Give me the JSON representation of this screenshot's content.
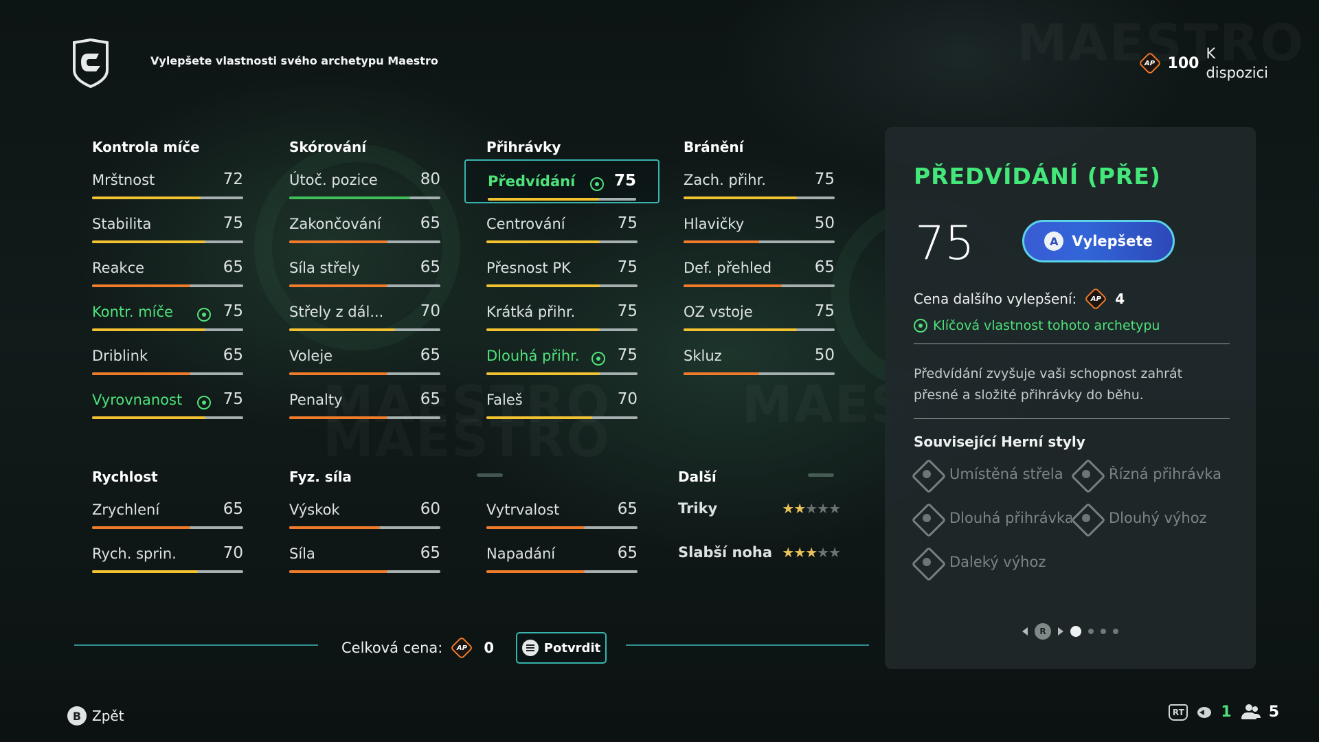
{
  "header": {
    "text": "Vylepšete vlastnosti svého archetypu Maestro",
    "ap_label": "AP",
    "ap_amount": "100",
    "ap_available_line1": "K",
    "ap_available_line2": "dispozici"
  },
  "columns": [
    {
      "title": "Kontrola míče",
      "stats": [
        {
          "name": "Mrštnost",
          "value": "72",
          "key": false,
          "fill": 0.72
        },
        {
          "name": "Stabilita",
          "value": "75",
          "key": false,
          "fill": 0.75
        },
        {
          "name": "Reakce",
          "value": "65",
          "key": false,
          "fill": 0.65
        },
        {
          "name": "Kontr. míče",
          "value": "75",
          "key": true,
          "fill": 0.75
        },
        {
          "name": "Driblink",
          "value": "65",
          "key": false,
          "fill": 0.65
        },
        {
          "name": "Vyrovnanost",
          "value": "75",
          "key": true,
          "fill": 0.75
        }
      ]
    },
    {
      "title": "Skórování",
      "stats": [
        {
          "name": "Útoč. pozice",
          "value": "80",
          "key": false,
          "fill": 0.8
        },
        {
          "name": "Zakončování",
          "value": "65",
          "key": false,
          "fill": 0.65
        },
        {
          "name": "Síla střely",
          "value": "65",
          "key": false,
          "fill": 0.65
        },
        {
          "name": "Střely z dál...",
          "value": "70",
          "key": false,
          "fill": 0.7
        },
        {
          "name": "Voleje",
          "value": "65",
          "key": false,
          "fill": 0.65
        },
        {
          "name": "Penalty",
          "value": "65",
          "key": false,
          "fill": 0.65
        }
      ]
    },
    {
      "title": "Přihrávky",
      "stats": [
        {
          "name": "Předvídání",
          "value": "75",
          "key": true,
          "fill": 0.75,
          "selected": true
        },
        {
          "name": "Centrování",
          "value": "75",
          "key": false,
          "fill": 0.75
        },
        {
          "name": "Přesnost PK",
          "value": "75",
          "key": false,
          "fill": 0.75
        },
        {
          "name": "Krátká přihr.",
          "value": "75",
          "key": false,
          "fill": 0.75
        },
        {
          "name": "Dlouhá přihr.",
          "value": "75",
          "key": true,
          "fill": 0.75
        },
        {
          "name": "Faleš",
          "value": "70",
          "key": false,
          "fill": 0.7
        }
      ]
    },
    {
      "title": "Bránění",
      "stats": [
        {
          "name": "Zach. přihr.",
          "value": "75",
          "key": false,
          "fill": 0.75
        },
        {
          "name": "Hlavičky",
          "value": "50",
          "key": false,
          "fill": 0.5
        },
        {
          "name": "Def. přehled",
          "value": "65",
          "key": false,
          "fill": 0.65
        },
        {
          "name": "OZ vstoje",
          "value": "75",
          "key": false,
          "fill": 0.75
        },
        {
          "name": "Skluz",
          "value": "50",
          "key": false,
          "fill": 0.5
        }
      ]
    }
  ],
  "rychlost": {
    "title": "Rychlost",
    "stats": [
      {
        "name": "Zrychlení",
        "value": "65",
        "fill": 0.65
      },
      {
        "name": "Rych. sprin.",
        "value": "70",
        "fill": 0.7
      }
    ]
  },
  "fyz": {
    "title": "Fyz. síla",
    "stats": [
      {
        "name": "Výskok",
        "value": "60",
        "fill": 0.6
      },
      {
        "name": "Síla",
        "value": "65",
        "fill": 0.65
      }
    ]
  },
  "fyz2": {
    "stats": [
      {
        "name": "Vytrvalost",
        "value": "65",
        "fill": 0.65
      },
      {
        "name": "Napadání",
        "value": "65",
        "fill": 0.65
      }
    ]
  },
  "dalsi": {
    "title": "Další",
    "rows": [
      {
        "name": "Triky",
        "stars": 2,
        "max": 5
      },
      {
        "name": "Slabší noha",
        "stars": 3,
        "max": 5
      }
    ]
  },
  "bottom": {
    "total_label": "Celková cena:",
    "total_amount": "0",
    "confirm_label": "Potvrdit"
  },
  "footer": {
    "back_button": "B",
    "back_label": "Zpět",
    "rt_label": "RT",
    "count_green": "1",
    "count_white": "5"
  },
  "panel": {
    "title": "PŘEDVÍDÁNÍ (PŘE)",
    "value": "75",
    "upgrade_button_glyph": "A",
    "upgrade_label": "Vylepšete",
    "cost_label": "Cena dalšího vylepšení:",
    "cost_amount": "4",
    "key_note": "Klíčová vlastnost tohoto archetypu",
    "description": "Předvídání zvyšuje vaši schopnost zahrát přesné a složité přihrávky do běhu.",
    "related_title": "Související Herní styly",
    "playstyles": [
      "Umístěná střela",
      "Řízná přihrávka",
      "Dlouhá přihrávka",
      "Dlouhý výhoz",
      "Daleký výhoz"
    ],
    "pager_button": "R",
    "pager_pages": 4,
    "pager_active": 0
  },
  "background_words": [
    "MAESTRO",
    "MAESTRO",
    "MAESTRO",
    "MAESTRO"
  ],
  "colors": {
    "accent_green": "#4fe27b",
    "bar_orange": "#f07b2a",
    "bar_yellow": "#f2c230",
    "bar_green": "#3fbf5a",
    "selection_teal": "#38b4ae",
    "upgrade_blue": "#3266d8"
  }
}
